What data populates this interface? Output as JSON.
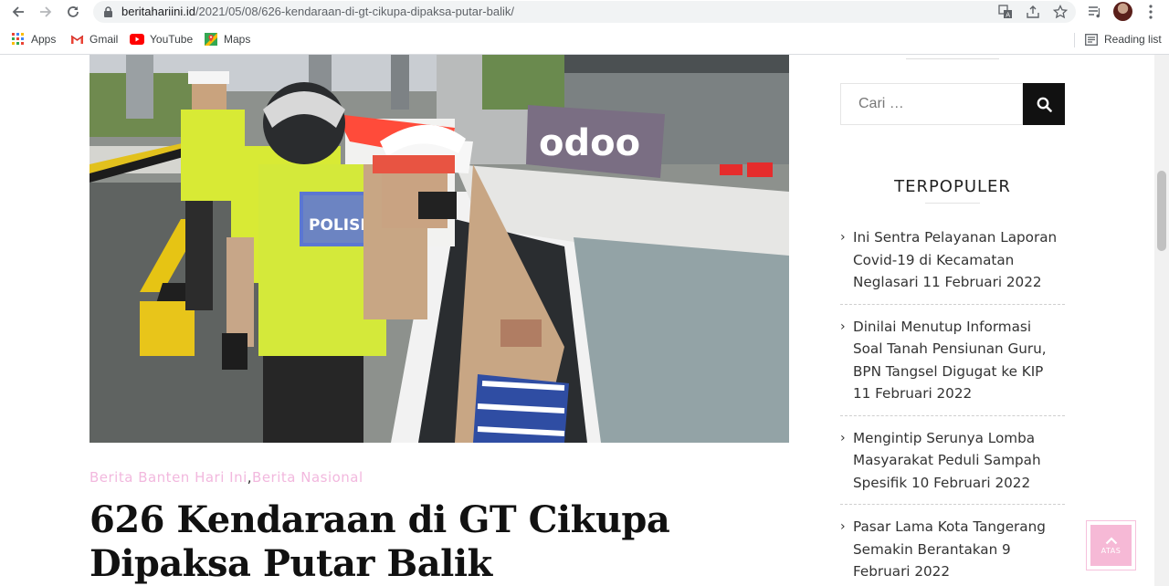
{
  "browser": {
    "url_host": "beritahariini.id",
    "url_path": "/2021/05/08/626-kendaraan-di-gt-cikupa-dipaksa-putar-balik/",
    "bookmarks": [
      {
        "label": "Apps",
        "icon": "apps-grid-icon"
      },
      {
        "label": "Gmail",
        "icon": "gmail-icon"
      },
      {
        "label": "YouTube",
        "icon": "youtube-icon"
      },
      {
        "label": "Maps",
        "icon": "maps-icon"
      }
    ],
    "reading_list_label": "Reading list"
  },
  "article": {
    "categories": [
      "Berita Banten Hari Ini",
      "Berita Nasional"
    ],
    "category_separator": ",",
    "title": "626 Kendaraan di GT Cikupa Dipaksa Putar Balik",
    "image_texts": {
      "car_sign": "odoo",
      "vest": "POLISI"
    }
  },
  "sidebar": {
    "search_placeholder": "Cari …",
    "popular_title": "TERPOPULER",
    "popular_items": [
      "Ini Sentra Pelayanan Laporan Covid-19 di Kecamatan Neglasari 11 Februari 2022",
      "Dinilai Menutup Informasi Soal Tanah Pensiunan Guru, BPN Tangsel Digugat ke KIP 11 Februari 2022",
      "Mengintip Serunya Lomba Masyarakat Peduli Sampah Spesifik 10 Februari 2022",
      "Pasar Lama Kota Tangerang Semakin Berantakan 9 Februari 2022"
    ],
    "back_to_top_label": "ATAS"
  },
  "colors": {
    "category": "#f2b8de",
    "back_to_top": "#f6b9d6",
    "search_button": "#111111"
  }
}
